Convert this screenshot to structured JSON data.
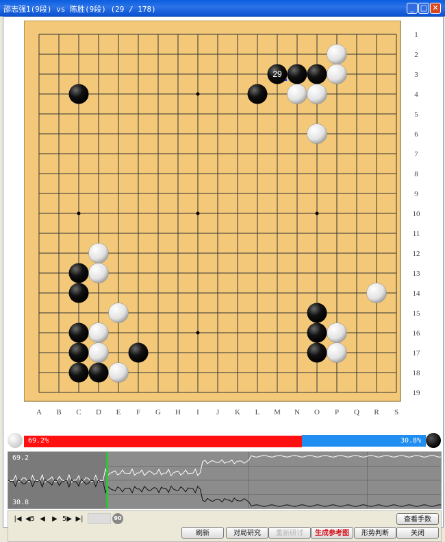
{
  "window": {
    "title": "邵志强1(9段) vs 陈胜(9段)  (29 / 178)",
    "controls": [
      "_",
      "□",
      "✕"
    ]
  },
  "board": {
    "size": 19,
    "col_labels": [
      "A",
      "B",
      "C",
      "D",
      "E",
      "F",
      "G",
      "H",
      "I",
      "J",
      "K",
      "L",
      "M",
      "N",
      "O",
      "P",
      "Q",
      "R",
      "S"
    ],
    "row_labels": [
      "1",
      "2",
      "3",
      "4",
      "5",
      "6",
      "7",
      "8",
      "9",
      "10",
      "11",
      "12",
      "13",
      "14",
      "15",
      "16",
      "17",
      "18",
      "19"
    ],
    "star_points": [
      [
        2,
        3
      ],
      [
        8,
        3
      ],
      [
        14,
        3
      ],
      [
        2,
        9
      ],
      [
        8,
        9
      ],
      [
        14,
        9
      ],
      [
        2,
        15
      ],
      [
        8,
        15
      ],
      [
        14,
        15
      ]
    ],
    "black_stones": [
      [
        2,
        3
      ],
      [
        11,
        3
      ],
      [
        13,
        2
      ],
      [
        14,
        2
      ],
      [
        2,
        12
      ],
      [
        2,
        13
      ],
      [
        14,
        14
      ],
      [
        14,
        15
      ],
      [
        14,
        16
      ],
      [
        2,
        15
      ],
      [
        2,
        16
      ],
      [
        2,
        17
      ],
      [
        3,
        17
      ],
      [
        5,
        16
      ]
    ],
    "white_stones": [
      [
        15,
        1
      ],
      [
        15,
        2
      ],
      [
        13,
        3
      ],
      [
        14,
        3
      ],
      [
        14,
        5
      ],
      [
        3,
        11
      ],
      [
        3,
        12
      ],
      [
        17,
        13
      ],
      [
        4,
        14
      ],
      [
        3,
        15
      ],
      [
        3,
        16
      ],
      [
        4,
        17
      ],
      [
        15,
        15
      ],
      [
        15,
        16
      ]
    ],
    "last_move": {
      "col": 12,
      "row": 2,
      "number": "29"
    }
  },
  "score": {
    "white_pct": "69.2%",
    "black_pct": "30.8%",
    "white_fraction": 0.692
  },
  "graph": {
    "top_label": "69.2",
    "bottom_label": "30.8",
    "current_move": 29,
    "total_moves": 178
  },
  "nav": {
    "first": "|◀",
    "back5": "◀5",
    "back": "◀",
    "fwd": "▶",
    "fwd5": "5▶",
    "last": "▶|",
    "badge": "90"
  },
  "buttons": {
    "view_moves": "查看手数",
    "refresh": "刷新",
    "study": "对局研究",
    "restudy": "重新研讨",
    "generate": "生成参考图",
    "judge": "形势判断",
    "close": "关闭"
  }
}
